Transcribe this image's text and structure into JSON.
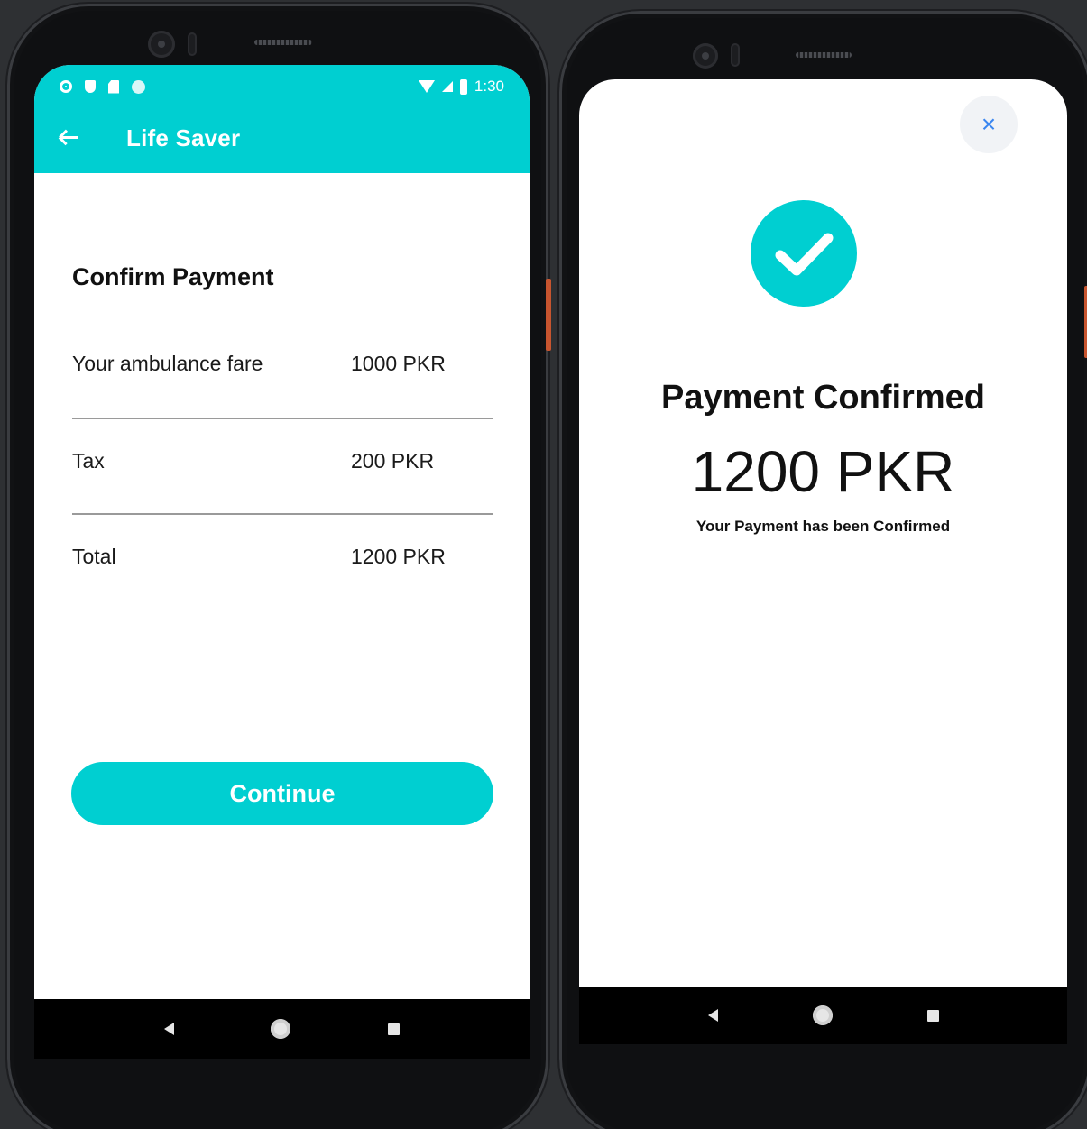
{
  "left_screen": {
    "status_bar": {
      "time": "1:30"
    },
    "app_bar": {
      "title": "Life Saver"
    },
    "confirm_payment": {
      "heading": "Confirm Payment",
      "rows": [
        {
          "label": "Your ambulance fare",
          "value": "1000 PKR"
        },
        {
          "label": "Tax",
          "value": "200 PKR"
        },
        {
          "label": "Total",
          "value": "1200 PKR"
        }
      ],
      "continue_label": "Continue"
    }
  },
  "right_screen": {
    "close_symbol": "×",
    "title": "Payment Confirmed",
    "amount": "1200 PKR",
    "subtitle": "Your Payment has been Confirmed"
  },
  "colors": {
    "accent": "#00cfd1",
    "close_icon": "#3a86f0",
    "background": "#2e3033"
  },
  "icons": [
    "settings-icon",
    "shield-icon",
    "sd-card-icon",
    "sync-icon",
    "wifi-icon",
    "signal-icon",
    "battery-icon",
    "back-arrow-icon",
    "close-icon",
    "check-icon",
    "nav-back-icon",
    "nav-home-icon",
    "nav-recents-icon"
  ]
}
